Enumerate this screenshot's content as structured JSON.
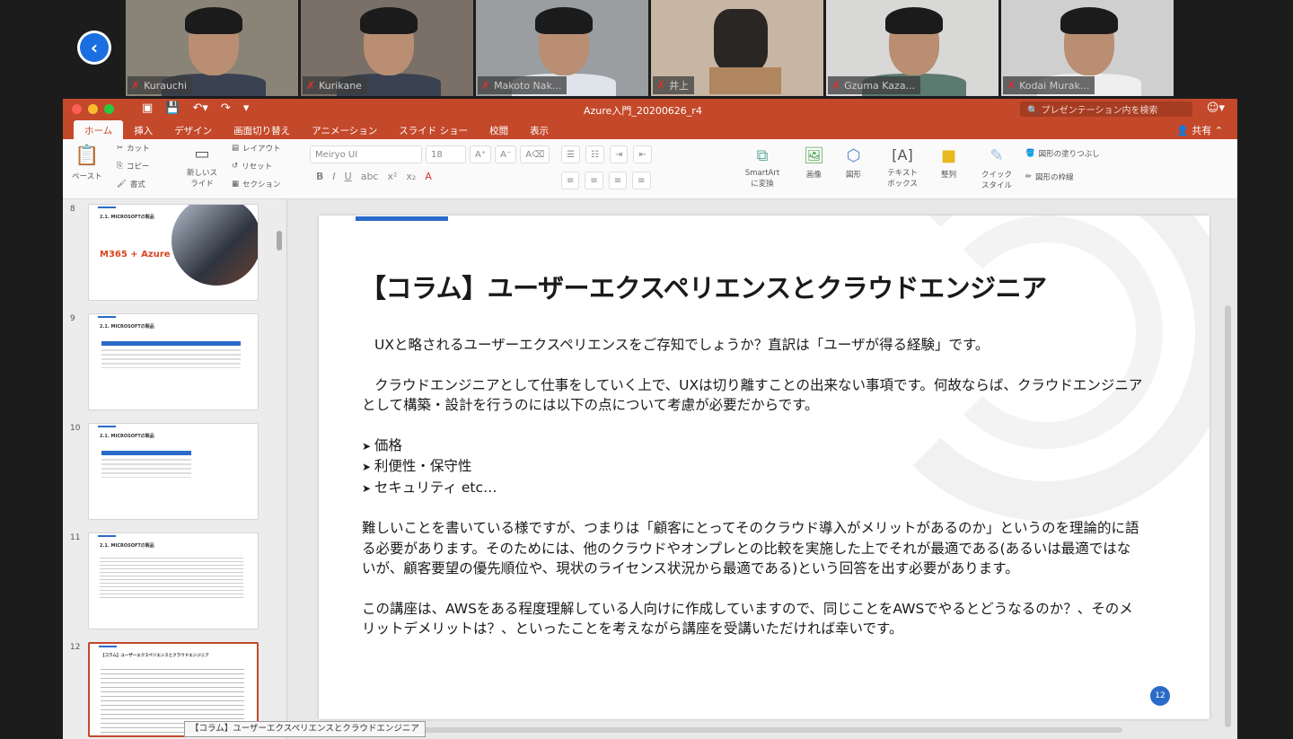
{
  "participants": [
    {
      "name": "Kurauchi"
    },
    {
      "name": "Kurikane"
    },
    {
      "name": "Makoto Nak..."
    },
    {
      "name": "井上"
    },
    {
      "name": "Gzuma Kaza..."
    },
    {
      "name": "Kodai Murak..."
    }
  ],
  "window": {
    "title": "Azure入門_20200626_r4",
    "search_placeholder": "プレゼンテーション内を検索",
    "tabs": [
      "ホーム",
      "挿入",
      "デザイン",
      "画面切り替え",
      "アニメーション",
      "スライド ショー",
      "校閲",
      "表示"
    ],
    "active_tab": "ホーム",
    "share_label": "共有"
  },
  "ribbon": {
    "paste": "ペースト",
    "cut": "カット",
    "copy": "コピー",
    "format": "書式",
    "new_slide": "新しいスライド",
    "layout": "レイアウト",
    "reset": "リセット",
    "section": "セクション",
    "font": "Meiryo UI",
    "font_size": "18",
    "smartart": "SmartArtに変換",
    "picture": "画像",
    "shape": "図形",
    "textbox": "テキストボックス",
    "arrange": "整列",
    "quick_style": "クイックスタイル",
    "fill": "図形の塗りつぶし",
    "outline": "図形の枠線"
  },
  "thumbnails": [
    {
      "num": "8",
      "title": "2.1. MICROSOFTの製品",
      "big": "M365 + Azure"
    },
    {
      "num": "9",
      "title": "2.1. MICROSOFTの製品"
    },
    {
      "num": "10",
      "title": "2.1. MICROSOFTの製品"
    },
    {
      "num": "11",
      "title": "2.1. MICROSOFTの製品"
    },
    {
      "num": "12",
      "title": "【コラム】ユーザーエクスペリエンスとクラウドエンジニア"
    }
  ],
  "slide": {
    "title": "【コラム】ユーザーエクスペリエンスとクラウドエンジニア",
    "p1": "UXと略されるユーザーエクスペリエンスをご存知でしょうか？直訳は「ユーザが得る経験」です。",
    "p2": "クラウドエンジニアとして仕事をしていく上で、UXは切り離すことの出来ない事項です。何故ならば、クラウドエンジニアとして構築・設計を行うのには以下の点について考慮が必要だからです。",
    "bullets": [
      "価格",
      "利便性・保守性",
      "セキュリティ etc…"
    ],
    "p3": "難しいことを書いている様ですが、つまりは「顧客にとってそのクラウド導入がメリットがあるのか」というのを理論的に語る必要があります。そのためには、他のクラウドやオンプレとの比較を実施した上でそれが最適である(あるいは最適ではないが、顧客要望の優先順位や、現状のライセンス状況から最適である)という回答を出す必要があります。",
    "p4": "この講座は、AWSをある程度理解している人向けに作成していますので、同じことをAWSでやるとどうなるのか？、そのメリットデメリットは？、といったことを考えながら講座を受講いただければ幸いです。",
    "page_number": "12"
  },
  "tooltip": "【コラム】ユーザーエクスペリエンスとクラウドエンジニア",
  "colors": {
    "accent": "#c4482a",
    "blue": "#2a6ac8"
  }
}
